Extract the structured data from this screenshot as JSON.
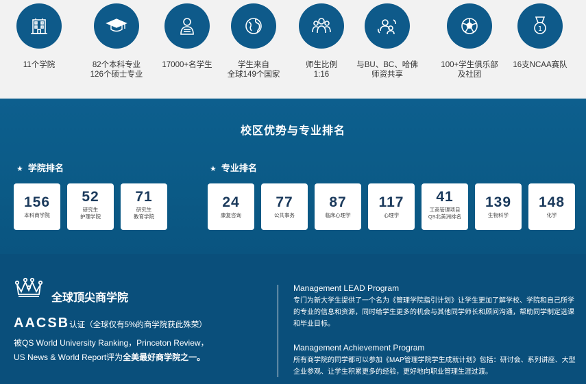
{
  "stats": [
    {
      "icon": "building-icon",
      "lines": [
        "11个学院"
      ]
    },
    {
      "icon": "graduation-cap-icon",
      "lines": [
        "82个本科专业",
        "126个硕士专业"
      ]
    },
    {
      "icon": "student-icon",
      "lines": [
        "17000+名学生"
      ]
    },
    {
      "icon": "globe-icon",
      "lines": [
        "学生来自",
        "全球149个国家"
      ]
    },
    {
      "icon": "group-icon",
      "lines": [
        "师生比例",
        "1:16"
      ]
    },
    {
      "icon": "shared-faculty-icon",
      "lines": [
        "与BU、BC、哈佛",
        "师资共享"
      ]
    },
    {
      "icon": "soccer-ball-icon",
      "lines": [
        "100+学生俱乐部",
        "及社团"
      ]
    },
    {
      "icon": "medal-icon",
      "lines": [
        "16支NCAA赛队"
      ]
    }
  ],
  "rankings": {
    "title": "校区优势与专业排名",
    "college": {
      "title": "学院排名",
      "cards": [
        {
          "num": "156",
          "sub": [
            "本科商学院"
          ]
        },
        {
          "num": "52",
          "sub": [
            "研究生",
            "护理学院"
          ]
        },
        {
          "num": "71",
          "sub": [
            "研究生",
            "教育学院"
          ]
        }
      ]
    },
    "major": {
      "title": "专业排名",
      "cards": [
        {
          "num": "24",
          "sub": [
            "康复咨询"
          ]
        },
        {
          "num": "77",
          "sub": [
            "公共事务"
          ]
        },
        {
          "num": "87",
          "sub": [
            "临床心理学"
          ]
        },
        {
          "num": "117",
          "sub": [
            "心理学"
          ]
        },
        {
          "num": "41",
          "sub": [
            "工商管理项目",
            "QS北美洲排名"
          ]
        },
        {
          "num": "139",
          "sub": [
            "生物科学"
          ]
        },
        {
          "num": "148",
          "sub": [
            "化学"
          ]
        }
      ]
    }
  },
  "business": {
    "title": "全球顶尖商学院",
    "aacsb": "AACSB",
    "aacsb_note": "认证（全球仅有5%的商学院获此殊荣）",
    "line1": "被QS World University Ranking，Princeton Review，",
    "line2_a": "US News & World  Report评为",
    "line2_b": "全美最好商学院之一。"
  },
  "programs": [
    {
      "title": "Management LEAD Program",
      "desc": "专门为新大学生提供了一个名为《管理学院指引计划》让学生更加了解学校、学院和自己所学的专业的信息和资源，同时给学生更多的机会与其他同学师长和顾问沟通，帮助同学制定选课和毕业目标。"
    },
    {
      "title": "Management Achievement Program",
      "desc": "所有商学院的同学都可以参加《MAP管理学院学生成就计划》包括：研讨会、系列讲座、大型企业参观、让学生积累更多的经验，更好地向职业管理生涯过渡。"
    }
  ],
  "colors": {
    "primary": "#0e5a8a",
    "band": "#0b5a86",
    "bottom": "#0a4f7b"
  }
}
